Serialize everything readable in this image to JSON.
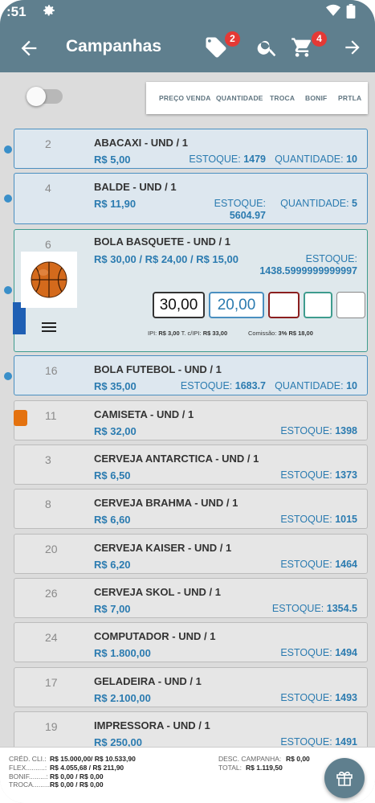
{
  "status": {
    "time": ":51"
  },
  "appbar": {
    "title": "Campanhas",
    "tag_badge": "2",
    "cart_badge": "4",
    "colors": {
      "bar": "#5f7f8e",
      "badge": "#e53935"
    }
  },
  "columns": [
    "PREÇO VENDA",
    "QUANTIDADE",
    "TROCA",
    "BONIF",
    "PRTLA"
  ],
  "items": [
    {
      "code": "2",
      "name": "ABACAXI - UND / 1",
      "price": "R$ 5,00",
      "stock_label": "ESTOQUE:",
      "stock": "1479",
      "qty_label": "QUANTIDADE:",
      "qty": "10"
    },
    {
      "code": "4",
      "name": "BALDE - UND / 1",
      "price": "R$ 11,90",
      "stock_label": "ESTOQUE:",
      "stock": "5604.97",
      "qty_label": "QUANTIDADE:",
      "qty": "5"
    },
    {
      "code": "6",
      "name": "BOLA BASQUETE - UND / 1",
      "price": "R$ 30,00 / R$ 24,00 / R$ 15,00",
      "stock_label": "ESTOQUE:",
      "stock": "1438.5999999999997",
      "input_price": "30,00",
      "input_qty": "20,00",
      "ipi_label": "IPI:",
      "ipi": "R$ 3,00",
      "tcipi_label": "T. c/IPI:",
      "tcipi": "R$ 33,00",
      "com_label": "Comissão:",
      "com": "3% R$ 18,00"
    },
    {
      "code": "16",
      "name": "BOLA FUTEBOL - UND / 1",
      "price": "R$ 35,00",
      "stock_label": "ESTOQUE:",
      "stock": "1683.7",
      "qty_label": "QUANTIDADE:",
      "qty": "10"
    },
    {
      "code": "11",
      "name": "CAMISETA - UND / 1",
      "price": "R$ 32,00",
      "stock_label": "ESTOQUE:",
      "stock": "1398"
    },
    {
      "code": "3",
      "name": "CERVEJA ANTARCTICA - UND / 1",
      "price": "R$ 6,50",
      "stock_label": "ESTOQUE:",
      "stock": "1373"
    },
    {
      "code": "8",
      "name": "CERVEJA BRAHMA - UND / 1",
      "price": "R$ 6,60",
      "stock_label": "ESTOQUE:",
      "stock": "1015"
    },
    {
      "code": "20",
      "name": "CERVEJA KAISER - UND / 1",
      "price": "R$ 6,20",
      "stock_label": "ESTOQUE:",
      "stock": "1464"
    },
    {
      "code": "26",
      "name": "CERVEJA SKOL - UND / 1",
      "price": "R$ 7,00",
      "stock_label": "ESTOQUE:",
      "stock": "1354.5"
    },
    {
      "code": "24",
      "name": "COMPUTADOR - UND / 1",
      "price": "R$ 1.800,00",
      "stock_label": "ESTOQUE:",
      "stock": "1494"
    },
    {
      "code": "17",
      "name": "GELADEIRA - UND / 1",
      "price": "R$ 2.100,00",
      "stock_label": "ESTOQUE:",
      "stock": "1493"
    },
    {
      "code": "19",
      "name": "IMPRESSORA - UND / 1",
      "price": "R$ 250,00",
      "stock_label": "ESTOQUE:",
      "stock": "1491"
    }
  ],
  "footer": {
    "cred_label": "CRÉD. CLI.:",
    "cred": "R$ 15.000,00/ R$ 10.533,90",
    "flex_label": "FLEX..........:",
    "flex": "R$ 4.055,68 / R$ 211,90",
    "bonif_label": "BONIF.........:",
    "bonif": "R$ 0,00 / R$ 0,00",
    "troca_label": "TROCA.........:",
    "troca": "R$ 0,00 / R$ 0,00",
    "desc_label": "DESC. CAMPANHA:",
    "desc": "R$ 0,00",
    "total_label": "TOTAL:",
    "total": "R$ 1.119,50"
  }
}
